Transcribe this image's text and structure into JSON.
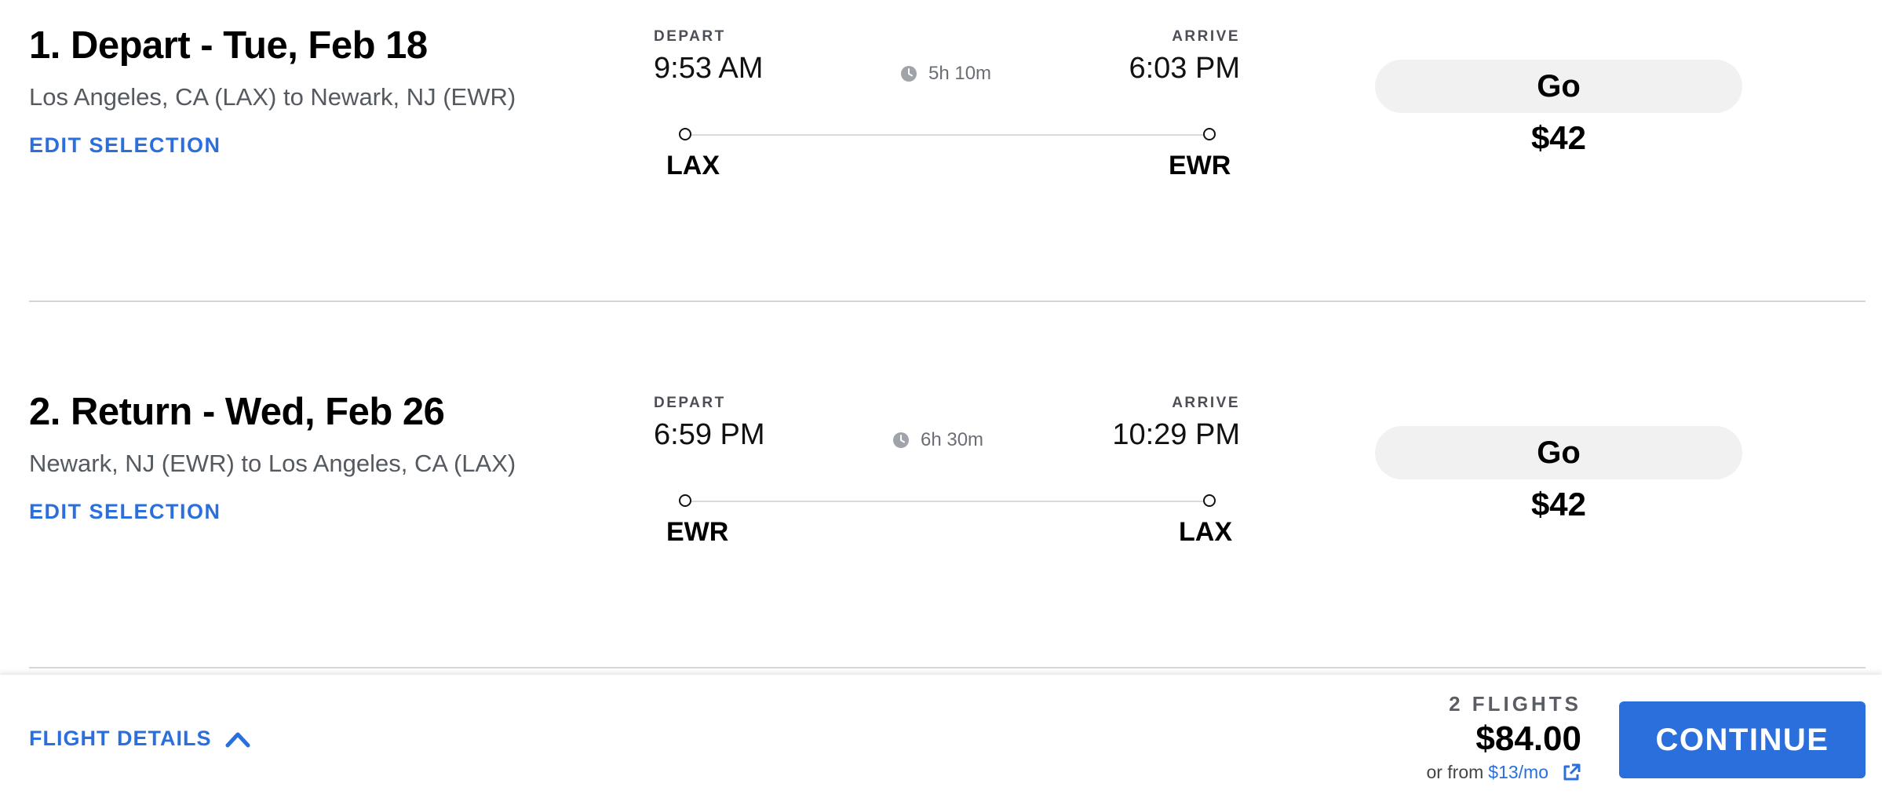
{
  "flights": [
    {
      "title": "1. Depart - Tue, Feb 18",
      "route": "Los Angeles, CA (LAX) to Newark, NJ (EWR)",
      "edit_label": "EDIT SELECTION",
      "depart_caption": "DEPART",
      "depart_time": "9:53 AM",
      "arrive_caption": "ARRIVE",
      "arrive_time": "6:03 PM",
      "duration": "5h 10m",
      "origin": "LAX",
      "destination": "EWR",
      "fare_name": "Go",
      "fare_price": "$42"
    },
    {
      "title": "2. Return - Wed, Feb 26",
      "route": "Newark, NJ (EWR) to Los Angeles, CA (LAX)",
      "edit_label": "EDIT SELECTION",
      "depart_caption": "DEPART",
      "depart_time": "6:59 PM",
      "arrive_caption": "ARRIVE",
      "arrive_time": "10:29 PM",
      "duration": "6h 30m",
      "origin": "EWR",
      "destination": "LAX",
      "fare_name": "Go",
      "fare_price": "$42"
    }
  ],
  "footer": {
    "details_label": "FLIGHT DETAILS",
    "details_icon": "chevron-up-icon",
    "flights_count": "2 FLIGHTS",
    "total": "$84.00",
    "monthly_prefix": "or from",
    "monthly_amount": "$13/mo",
    "monthly_icon": "external-link-icon",
    "continue_label": "CONTINUE"
  },
  "colors": {
    "accent": "#2a6fdb",
    "pill_background": "#f1f1f1",
    "divider": "#d6d6d6"
  }
}
